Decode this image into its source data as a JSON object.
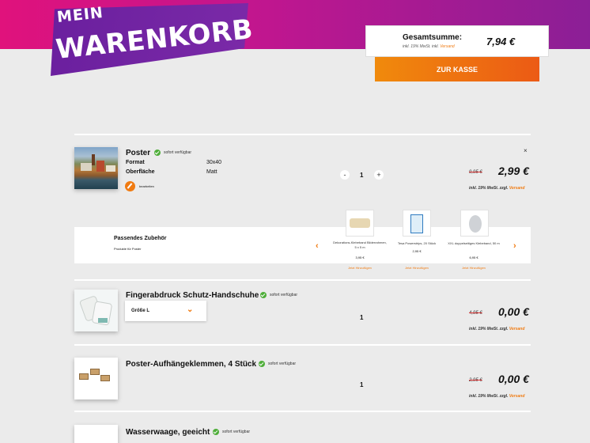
{
  "header": {
    "title_line1": "MEIN",
    "title_line2": "WARENKORB",
    "total_label": "Gesamtsumme:",
    "total_sub_prefix": "inkl. 19% MwSt. inkl.",
    "total_sub_link": "Versand",
    "total_value": "7,94 €",
    "checkout_label": "ZUR KASSE",
    "colors": {
      "accent": "#f07b12",
      "header_start": "#e0127c",
      "header_end": "#8b1f96",
      "badge": "#6a1f9e"
    }
  },
  "cart": {
    "items": [
      {
        "name": "Poster",
        "availability": "sofort verfügbar",
        "attributes": [
          {
            "label": "Format",
            "value": "30x40"
          },
          {
            "label": "Oberfläche",
            "value": "Matt"
          }
        ],
        "edit_label": "bearbeiten",
        "quantity": "1",
        "qty_minus": "-",
        "qty_plus": "+",
        "old_price": "9,95 €",
        "price": "2,99 €",
        "vat_prefix": "inkl. 19% MwSt. zzgl.",
        "vat_link": "Versand",
        "remove_icon": "×"
      },
      {
        "name": "Fingerabdruck Schutz-Handschuhe",
        "availability": "sofort verfügbar",
        "size_select": "Größe L",
        "quantity": "1",
        "old_price": "4,95 €",
        "price": "0,00 €",
        "vat_prefix": "inkl. 19% MwSt. zzgl.",
        "vat_link": "Versand"
      },
      {
        "name": "Poster-Aufhängeklemmen, 4 Stück",
        "availability": "sofort verfügbar",
        "quantity": "1",
        "old_price": "2,95 €",
        "price": "0,00 €",
        "vat_prefix": "inkl. 19% MwSt. zzgl.",
        "vat_link": "Versand"
      },
      {
        "name": "Wasserwaage, geeicht",
        "availability": "sofort verfügbar"
      }
    ]
  },
  "accessories": {
    "title": "Passendes Zubehör",
    "subtitle": "Produkte für Poster",
    "prev_icon": "‹",
    "next_icon": "›",
    "items": [
      {
        "name": "Dekorations-Klebeband Bilderrahmen, 5 x 5 m",
        "price": "3,95 €",
        "link": "Jetzt Hinzufügen"
      },
      {
        "name": "Tesa Powerstrips, 20 Stück",
        "price": "2,95 €",
        "link": "Jetzt Hinzufügen"
      },
      {
        "name": "XXL doppelseitiges Klebeband, 50 m",
        "price": "6,95 €",
        "link": "Jetzt Hinzufügen"
      }
    ]
  }
}
